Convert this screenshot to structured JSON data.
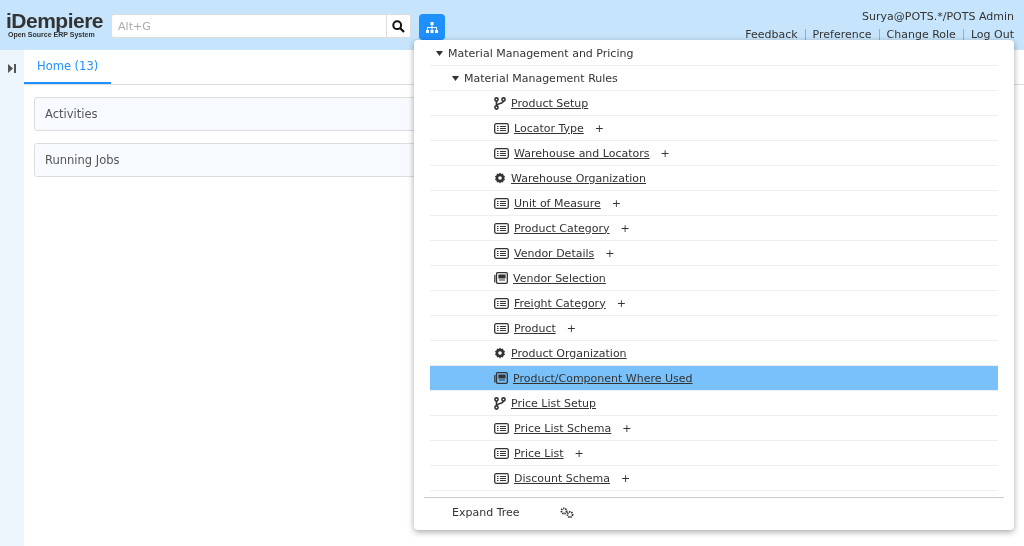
{
  "header": {
    "logo": "iDempiere",
    "logo_tagline": "Open Source ERP System",
    "search": {
      "placeholder": "Alt+G"
    },
    "user": "Surya@POTS.*/POTS Admin",
    "links": [
      "Feedback",
      "Preference",
      "Change Role",
      "Log Out"
    ]
  },
  "tabs": [
    {
      "label": "Home (13)",
      "selected": true
    }
  ],
  "panels": [
    {
      "title": "Activities"
    },
    {
      "title": "Running Jobs"
    }
  ],
  "menu_tree": {
    "expanded_button": true,
    "nodes": [
      {
        "label": "Material Management and Pricing",
        "expanded": true,
        "children": [
          {
            "label": "Material Management Rules",
            "expanded": true,
            "children": [
              {
                "label": "Product Setup",
                "kind": "workflow",
                "selected": false
              },
              {
                "label": "Locator Type",
                "kind": "window",
                "new": "+",
                "selected": false
              },
              {
                "label": "Warehouse and Locators",
                "kind": "window",
                "new": "+",
                "selected": false
              },
              {
                "label": "Warehouse Organization",
                "kind": "process",
                "selected": false
              },
              {
                "label": "Unit of Measure",
                "kind": "window",
                "new": "+",
                "selected": false
              },
              {
                "label": "Product Category",
                "kind": "window",
                "new": "+",
                "selected": false
              },
              {
                "label": "Vendor Details",
                "kind": "window",
                "new": "+",
                "selected": false
              },
              {
                "label": "Vendor Selection",
                "kind": "form",
                "selected": false
              },
              {
                "label": "Freight Category",
                "kind": "window",
                "new": "+",
                "selected": false
              },
              {
                "label": "Product",
                "kind": "window",
                "new": "+",
                "selected": false
              },
              {
                "label": "Product Organization",
                "kind": "process",
                "selected": false
              },
              {
                "label": "Product/Component Where Used",
                "kind": "form",
                "selected": true
              },
              {
                "label": "Price List Setup",
                "kind": "workflow",
                "selected": false
              },
              {
                "label": "Price List Schema",
                "kind": "window",
                "new": "+",
                "selected": false
              },
              {
                "label": "Price List",
                "kind": "window",
                "new": "+",
                "selected": false
              },
              {
                "label": "Discount Schema",
                "kind": "window",
                "new": "+",
                "selected": false
              }
            ]
          }
        ]
      }
    ],
    "footer": {
      "label": "Expand Tree"
    }
  }
}
